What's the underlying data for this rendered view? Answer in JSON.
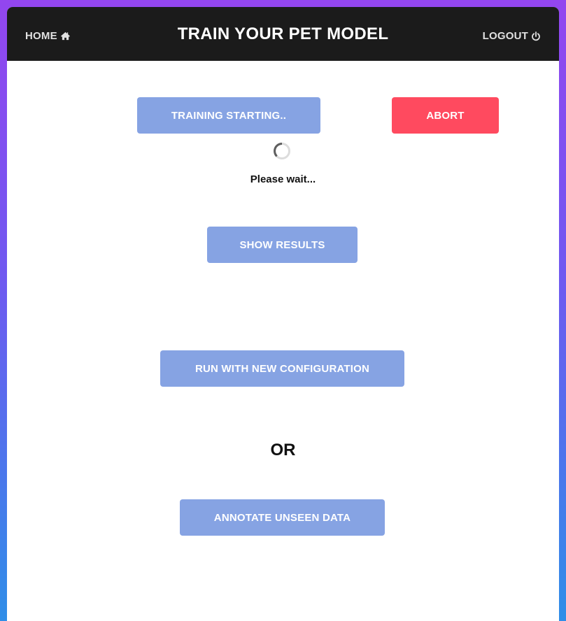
{
  "header": {
    "title": "TRAIN YOUR PET MODEL",
    "home_label": "HOME",
    "home_icon": "home-icon",
    "logout_label": "LOGOUT",
    "logout_icon": "power-icon"
  },
  "training": {
    "status_button_label": "TRAINING STARTING..",
    "abort_label": "ABORT",
    "spinner_icon": "loading-spinner-icon",
    "wait_text": "Please wait..."
  },
  "actions": {
    "show_results_label": "SHOW RESULTS",
    "run_new_config_label": "RUN WITH NEW CONFIGURATION",
    "or_text": "OR",
    "annotate_label": "ANNOTATE UNSEEN DATA"
  },
  "colors": {
    "topbar": "#1b1b1b",
    "primary_button": "#86a3e3",
    "danger_button": "#ff4a5f",
    "background_gradient_top": "#9346ef",
    "background_gradient_bottom": "#2f8ee8"
  }
}
